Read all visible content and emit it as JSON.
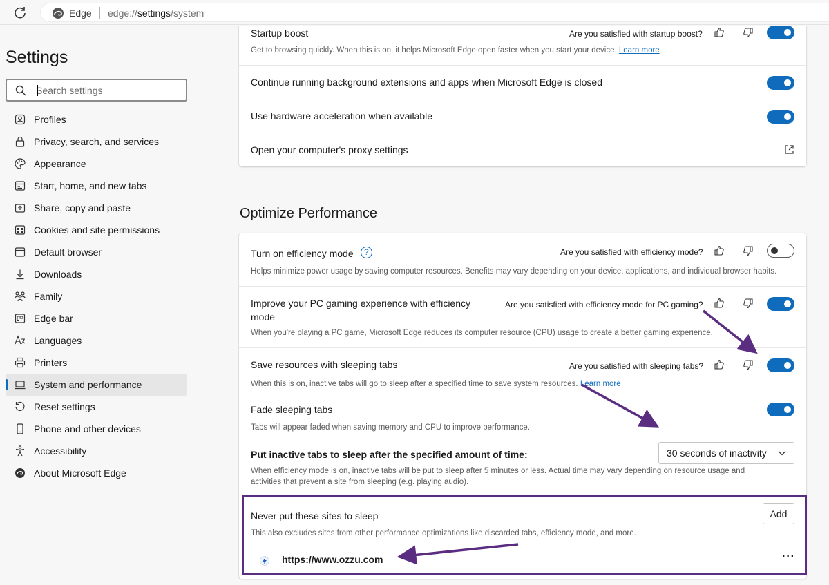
{
  "browser": {
    "brand": "Edge",
    "url_prefix": "edge://",
    "url_path": "settings",
    "url_suffix": "/system"
  },
  "sidebar": {
    "title": "Settings",
    "search_placeholder": "Search settings",
    "items": [
      {
        "label": "Profiles",
        "icon": "profile-icon"
      },
      {
        "label": "Privacy, search, and services",
        "icon": "lock-icon"
      },
      {
        "label": "Appearance",
        "icon": "palette-icon"
      },
      {
        "label": "Start, home, and new tabs",
        "icon": "home-tabs-icon"
      },
      {
        "label": "Share, copy and paste",
        "icon": "share-icon"
      },
      {
        "label": "Cookies and site permissions",
        "icon": "cookies-icon"
      },
      {
        "label": "Default browser",
        "icon": "browser-icon"
      },
      {
        "label": "Downloads",
        "icon": "download-icon"
      },
      {
        "label": "Family",
        "icon": "family-icon"
      },
      {
        "label": "Edge bar",
        "icon": "edge-bar-icon"
      },
      {
        "label": "Languages",
        "icon": "languages-icon"
      },
      {
        "label": "Printers",
        "icon": "printer-icon"
      },
      {
        "label": "System and performance",
        "icon": "laptop-icon",
        "active": true
      },
      {
        "label": "Reset settings",
        "icon": "reset-icon"
      },
      {
        "label": "Phone and other devices",
        "icon": "phone-icon"
      },
      {
        "label": "Accessibility",
        "icon": "accessibility-icon"
      },
      {
        "label": "About Microsoft Edge",
        "icon": "edge-logo-icon"
      }
    ]
  },
  "system": {
    "startup_boost": {
      "title": "Startup boost",
      "question": "Are you satisfied with startup boost?",
      "desc": "Get to browsing quickly. When this is on, it helps Microsoft Edge open faster when you start your device.",
      "link": "Learn more",
      "enabled": true
    },
    "background": {
      "title": "Continue running background extensions and apps when Microsoft Edge is closed",
      "enabled": true
    },
    "hardware": {
      "title": "Use hardware acceleration when available",
      "enabled": true
    },
    "proxy": {
      "title": "Open your computer's proxy settings",
      "icon": "external-link-icon"
    }
  },
  "performance": {
    "heading": "Optimize Performance",
    "efficiency": {
      "title": "Turn on efficiency mode",
      "help": "?",
      "question": "Are you satisfied with efficiency mode?",
      "desc": "Helps minimize power usage by saving computer resources. Benefits may vary depending on your device, applications, and individual browser habits.",
      "enabled": false
    },
    "gaming": {
      "title_line1": "Improve your PC gaming experience with efficiency",
      "title_line2": "mode",
      "question": "Are you satisfied with efficiency mode for PC gaming?",
      "desc": "When you're playing a PC game, Microsoft Edge reduces its computer resource (CPU) usage to create a better gaming experience.",
      "enabled": true
    },
    "sleeping": {
      "title": "Save resources with sleeping tabs",
      "question": "Are you satisfied with sleeping tabs?",
      "desc": "When this is on, inactive tabs will go to sleep after a specified time to save system resources.",
      "link": "Learn more",
      "enabled": true
    },
    "fade": {
      "title": "Fade sleeping tabs",
      "desc": "Tabs will appear faded when saving memory and CPU to improve performance.",
      "enabled": true
    },
    "inactive": {
      "title": "Put inactive tabs to sleep after the specified amount of time:",
      "selected": "30 seconds of inactivity",
      "desc_line1": "When efficiency mode is on, inactive tabs will be put to sleep after 5 minutes or less. Actual time may vary depending on resource usage and",
      "desc_line2": "activities that prevent a site from sleeping (e.g. playing audio)."
    },
    "never_sleep": {
      "title": "Never put these sites to sleep",
      "add": "Add",
      "desc": "This also excludes sites from other performance optimizations like discarded tabs, efficiency mode, and more.",
      "site": "https://www.ozzu.com",
      "more": "···"
    }
  },
  "colors": {
    "accent": "#0f6cbd",
    "annotation": "#5a2d81"
  }
}
